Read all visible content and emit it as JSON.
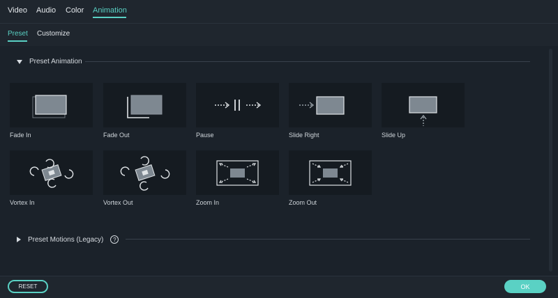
{
  "tabs": [
    {
      "label": "Video"
    },
    {
      "label": "Audio"
    },
    {
      "label": "Color"
    },
    {
      "label": "Animation",
      "active": true
    }
  ],
  "subtabs": [
    {
      "label": "Preset",
      "active": true
    },
    {
      "label": "Customize"
    }
  ],
  "sections": {
    "preset_animation": "Preset Animation",
    "preset_motions": "Preset Motions (Legacy)",
    "help": "?"
  },
  "presets": [
    {
      "label": "Fade In",
      "icon": "fade-in-icon"
    },
    {
      "label": "Fade Out",
      "icon": "fade-out-icon"
    },
    {
      "label": "Pause",
      "icon": "pause-icon"
    },
    {
      "label": "Slide Right",
      "icon": "slide-right-icon"
    },
    {
      "label": "Slide Up",
      "icon": "slide-up-icon"
    },
    {
      "label": "Vortex In",
      "icon": "vortex-in-icon"
    },
    {
      "label": "Vortex Out",
      "icon": "vortex-out-icon"
    },
    {
      "label": "Zoom In",
      "icon": "zoom-in-icon"
    },
    {
      "label": "Zoom Out",
      "icon": "zoom-out-icon"
    }
  ],
  "buttons": {
    "reset": "RESET",
    "ok": "OK"
  },
  "colors": {
    "accent": "#5ad1c4",
    "background": "#1b222a",
    "tile": "#151b21"
  }
}
